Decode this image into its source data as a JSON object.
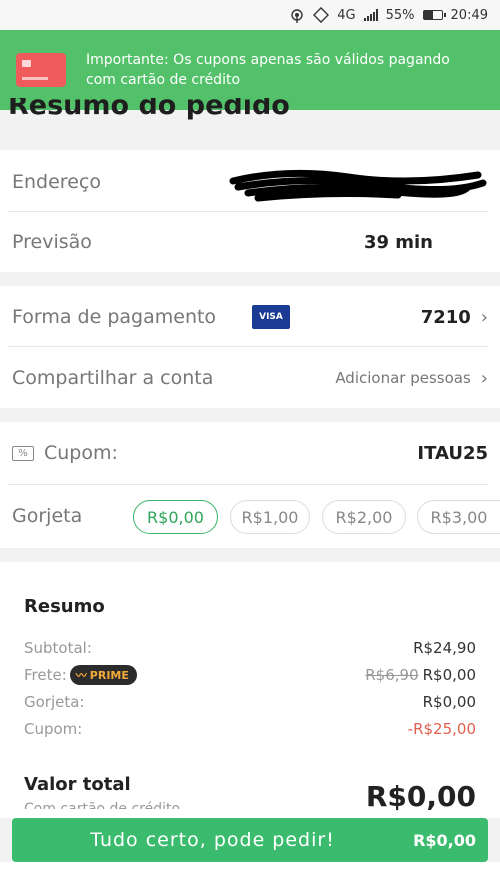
{
  "status_bar": {
    "network": "4G",
    "battery_level": "55%",
    "time": "20:49"
  },
  "toast": {
    "icon": "credit-card-icon",
    "message": "Importante: Os cupons apenas são válidos pagando com cartão de crédito",
    "background": "#53c16a"
  },
  "page_title": "Resumo do pedido",
  "delivery": {
    "address_label": "Endereço",
    "forecast_label": "Previsão",
    "forecast_value": "39 min"
  },
  "payment": {
    "method_label": "Forma de pagamento",
    "card_brand": "VISA",
    "card_last_digits": "7210",
    "share_label": "Compartilhar a conta",
    "share_action": "Adicionar pessoas"
  },
  "coupon": {
    "label": "Cupom:",
    "code": "ITAU25"
  },
  "tip": {
    "label": "Gorjeta",
    "options": [
      "R$0,00",
      "R$1,00",
      "R$2,00",
      "R$3,00"
    ],
    "selected": "R$0,00"
  },
  "summary": {
    "title": "Resumo",
    "subtotal_label": "Subtotal:",
    "subtotal_value": "R$24,90",
    "shipping_label": "Frete:",
    "prime_badge": "PRIME",
    "shipping_old_value": "R$6,90",
    "shipping_value": "R$0,00",
    "tip_label": "Gorjeta:",
    "tip_value": "R$0,00",
    "coupon_label": "Cupom:",
    "coupon_value": "-R$25,00",
    "total_label": "Valor total",
    "total_sub": "Com cartão de crédito",
    "total_value": "R$0,00"
  },
  "cta": {
    "label": "Tudo certo, pode pedir!",
    "price": "R$0,00",
    "color": "#3bbb6d"
  }
}
